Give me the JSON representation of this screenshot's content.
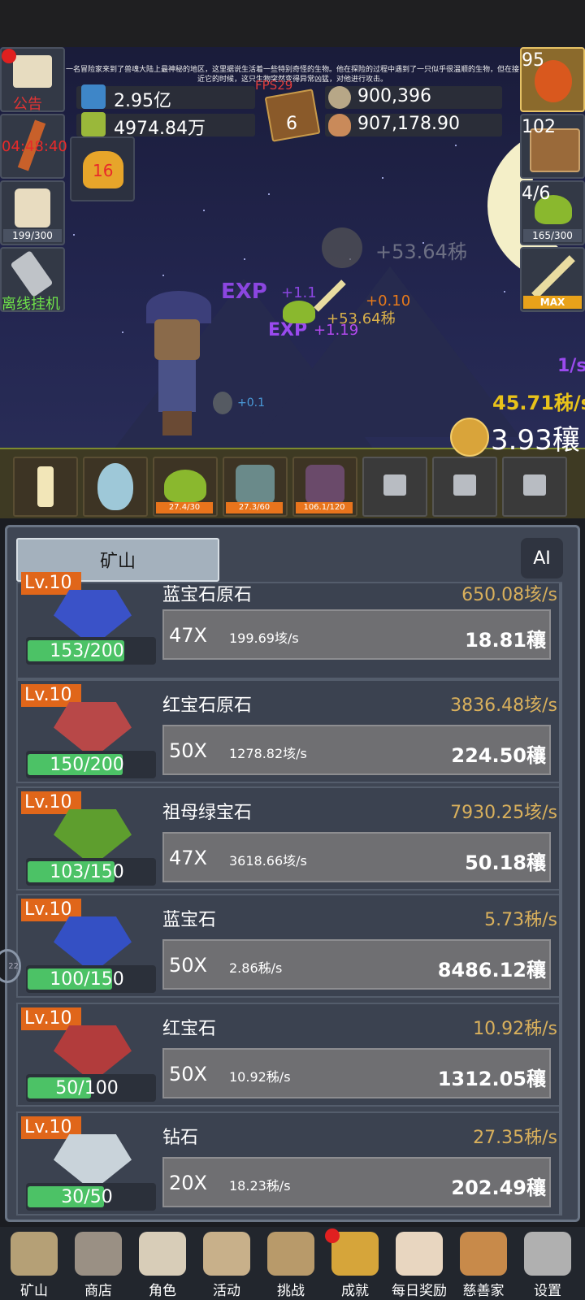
{
  "story_text": "一名冒险家来到了兽魂大陆上最神秘的地区，这里据说生活着一些特别奇怪的生物。他在探险的过程中遇到了一只似乎很温顺的生物，但在接近它的时候，这只生物突然变得异常凶猛，对他进行攻击。",
  "fps": "FPS29",
  "resources": {
    "potion_blue": "2.95亿",
    "potion_green": "4974.84万",
    "book_count": "6",
    "coin_silver": "900,396",
    "meat": "907,178.90"
  },
  "left_buttons": {
    "notice_label": "公告",
    "torch_timer": "04:48:40",
    "beer_progress": "199/300",
    "offline_label": "离线挂机",
    "key_count": "16"
  },
  "right_buttons": {
    "potion_count": "95",
    "chest_count": "102",
    "slime_count": "4/6",
    "slime_progress": "165/300",
    "sword_label": "MAX"
  },
  "floating": {
    "gold_gain": "+53.64秭",
    "exp1": "+1.1",
    "exp2": "+1.19",
    "orange_gain": "+0.10",
    "gold_gain2": "+53.64秭",
    "small1": "+0.1",
    "small2": "+0.1",
    "small3": "+0.1",
    "small4": "+0.1"
  },
  "rates": {
    "per_sec": "1/s",
    "gold_rate": "45.71秭/s",
    "gold_total": "3.93穰"
  },
  "slots": [
    {
      "progress": ""
    },
    {
      "progress": ""
    },
    {
      "progress": "27.4/30"
    },
    {
      "progress": "27.3/60"
    },
    {
      "progress": "106.1/120"
    }
  ],
  "panel": {
    "tab_label": "矿山",
    "ai_label": "AI"
  },
  "gems": [
    {
      "level": "Lv.10",
      "name": "蓝宝石原石",
      "rate": "650.08垓/s",
      "count": "153/200",
      "fill": 0.765,
      "mult": "47X",
      "sub": "199.69垓/s",
      "value": "18.81穰",
      "color": "#3a52c8"
    },
    {
      "level": "Lv.10",
      "name": "红宝石原石",
      "rate": "3836.48垓/s",
      "count": "150/200",
      "fill": 0.75,
      "mult": "50X",
      "sub": "1278.82垓/s",
      "value": "224.50穰",
      "color": "#b84848"
    },
    {
      "level": "Lv.10",
      "name": "祖母绿宝石",
      "rate": "7930.25垓/s",
      "count": "103/150",
      "fill": 0.687,
      "mult": "47X",
      "sub": "3618.66垓/s",
      "value": "50.18穰",
      "color": "#5e9e2e"
    },
    {
      "level": "Lv.10",
      "name": "蓝宝石",
      "rate": "5.73秭/s",
      "count": "100/150",
      "fill": 0.667,
      "mult": "50X",
      "sub": "2.86秭/s",
      "value": "8486.12穰",
      "color": "#3450c4"
    },
    {
      "level": "Lv.10",
      "name": "红宝石",
      "rate": "10.92秭/s",
      "count": "50/100",
      "fill": 0.5,
      "mult": "50X",
      "sub": "10.92秭/s",
      "value": "1312.05穰",
      "color": "#b23c3c"
    },
    {
      "level": "Lv.10",
      "name": "钻石",
      "rate": "27.35秭/s",
      "count": "30/50",
      "fill": 0.6,
      "mult": "20X",
      "sub": "18.23秭/s",
      "value": "202.49穰",
      "color": "#c9d3da"
    }
  ],
  "side_badge": "22",
  "nav": [
    "矿山",
    "商店",
    "角色",
    "活动",
    "挑战",
    "成就",
    "每日奖励",
    "慈善家",
    "设置"
  ]
}
